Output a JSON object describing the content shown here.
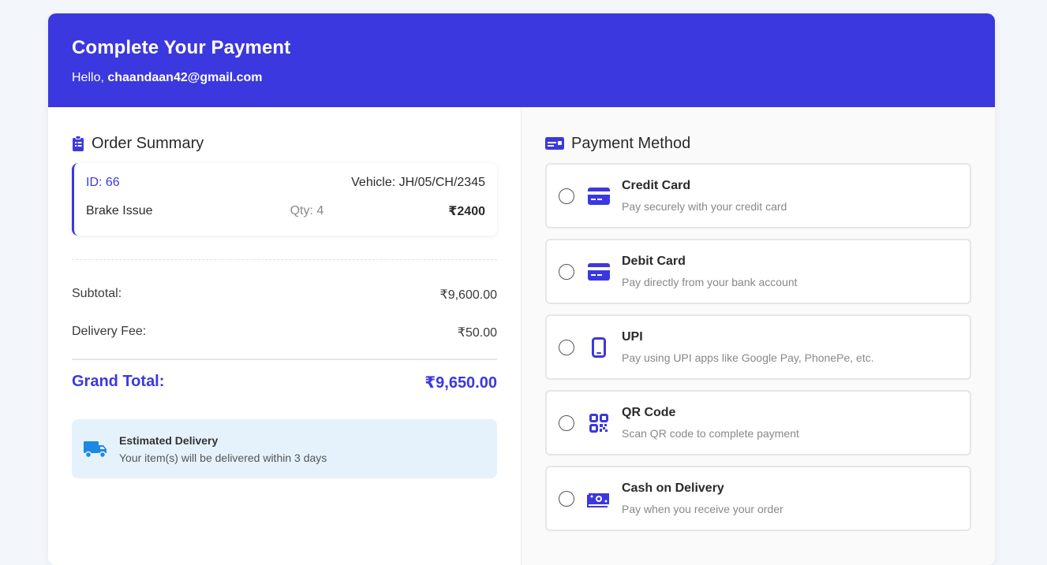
{
  "header": {
    "title": "Complete Your Payment",
    "greeting_prefix": "Hello,",
    "user_email": "chaandaan42@gmail.com"
  },
  "order_summary": {
    "title": "Order Summary",
    "item": {
      "id_label": "ID: 66",
      "vehicle_label": "Vehicle: JH/05/CH/2345",
      "service": "Brake Issue",
      "qty_label": "Qty: 4",
      "price": "₹2400"
    },
    "subtotal_label": "Subtotal:",
    "subtotal_value": "₹9,600.00",
    "delivery_fee_label": "Delivery Fee:",
    "delivery_fee_value": "₹50.00",
    "grand_total_label": "Grand Total:",
    "grand_total_value": "₹9,650.00",
    "estimated_delivery": {
      "title": "Estimated Delivery",
      "text": "Your item(s) will be delivered within 3 days"
    }
  },
  "payment_method": {
    "title": "Payment Method",
    "options": [
      {
        "icon": "credit-card-icon",
        "title": "Credit Card",
        "subtitle": "Pay securely with your credit card"
      },
      {
        "icon": "debit-card-icon",
        "title": "Debit Card",
        "subtitle": "Pay directly from your bank account"
      },
      {
        "icon": "mobile-phone-icon",
        "title": "UPI",
        "subtitle": "Pay using UPI apps like Google Pay, PhonePe, etc."
      },
      {
        "icon": "qr-code-icon",
        "title": "QR Code",
        "subtitle": "Scan QR code to complete payment"
      },
      {
        "icon": "cash-icon",
        "title": "Cash on Delivery",
        "subtitle": "Pay when you receive your order"
      }
    ]
  },
  "colors": {
    "primary": "#3b38e0",
    "page_background": "#f3f6fa",
    "delivery_box_background": "#e5f2fc",
    "truck_icon": "#1e88e5"
  }
}
